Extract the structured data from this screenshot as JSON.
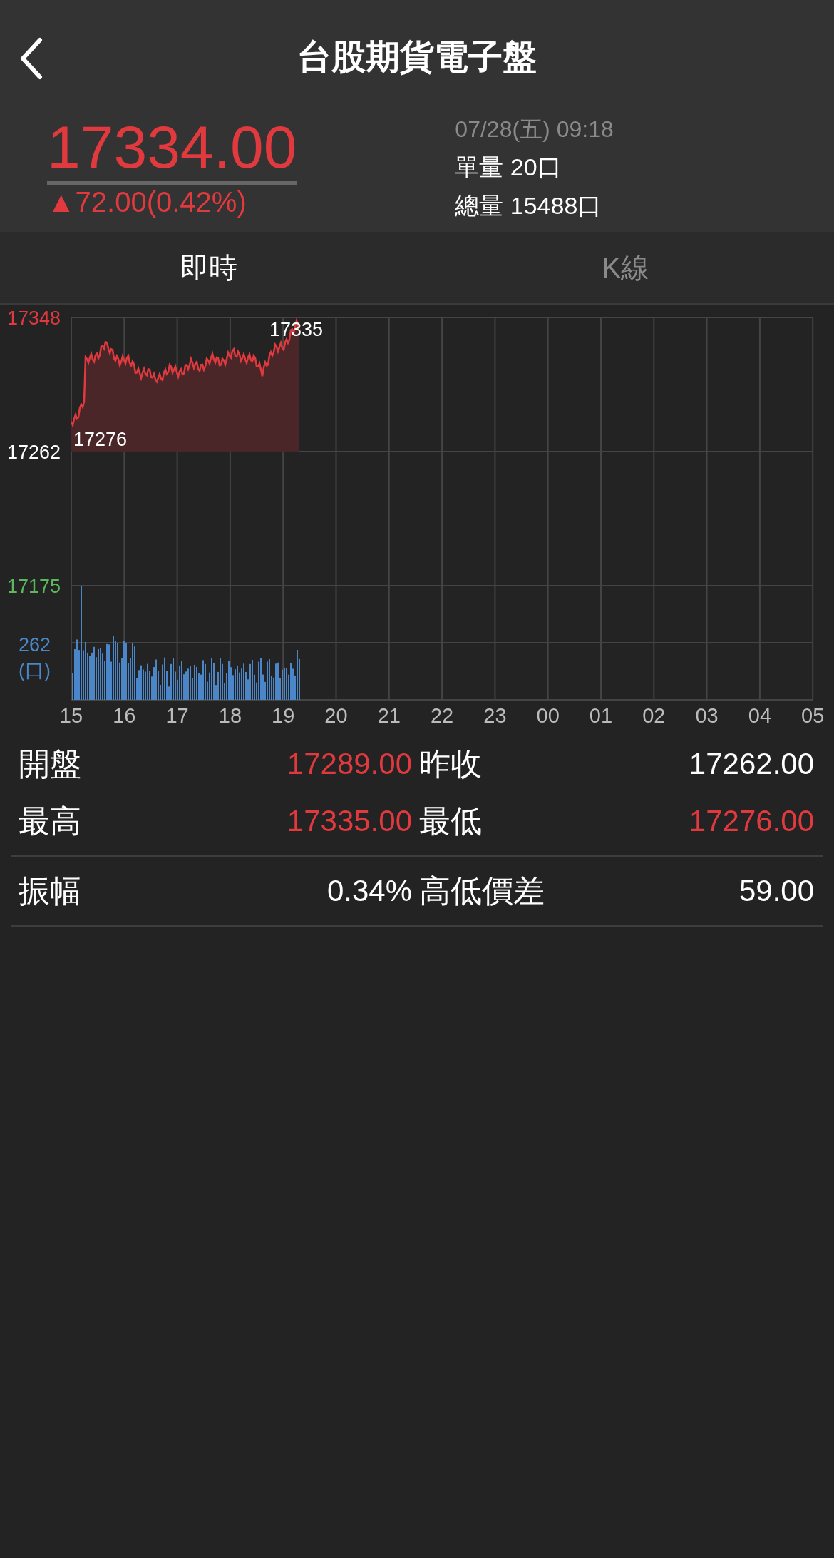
{
  "header": {
    "title": "台股期貨電子盤"
  },
  "quote": {
    "price": "17334.00",
    "change": "▲72.00(0.42%)",
    "color": "#e0393e",
    "time": "07/28(五) 09:18",
    "single_volume": "單量 20口",
    "total_volume": "總量 15488口"
  },
  "tabs": [
    {
      "label": "即時",
      "selected": true
    },
    {
      "label": "K線",
      "selected": false
    }
  ],
  "chart": {
    "y_labels": [
      {
        "text": "17348",
        "kind": "high"
      },
      {
        "text": "17262",
        "kind": "reference"
      },
      {
        "text": "17175",
        "kind": "low"
      },
      {
        "text": "262",
        "kind": "volume"
      },
      {
        "text": "(口)",
        "kind": "volume"
      }
    ],
    "high_mark": "17335",
    "low_mark": "17276",
    "x_labels": [
      "15",
      "16",
      "17",
      "18",
      "19",
      "20",
      "21",
      "22",
      "23",
      "00",
      "01",
      "02",
      "03",
      "04",
      "05"
    ]
  },
  "stats": [
    [
      {
        "label": "開盤",
        "value": "17289.00",
        "color": "#e0393e"
      },
      {
        "label": "昨收",
        "value": "17262.00",
        "color": "#ffffff"
      }
    ],
    [
      {
        "label": "最高",
        "value": "17335.00",
        "color": "#e0393e"
      },
      {
        "label": "最低",
        "value": "17276.00",
        "color": "#e0393e"
      }
    ],
    [
      {
        "label": "振幅",
        "value": "0.34%",
        "color": "#ffffff"
      },
      {
        "label": "高低價差",
        "value": "59.00",
        "color": "#ffffff"
      }
    ]
  ]
}
